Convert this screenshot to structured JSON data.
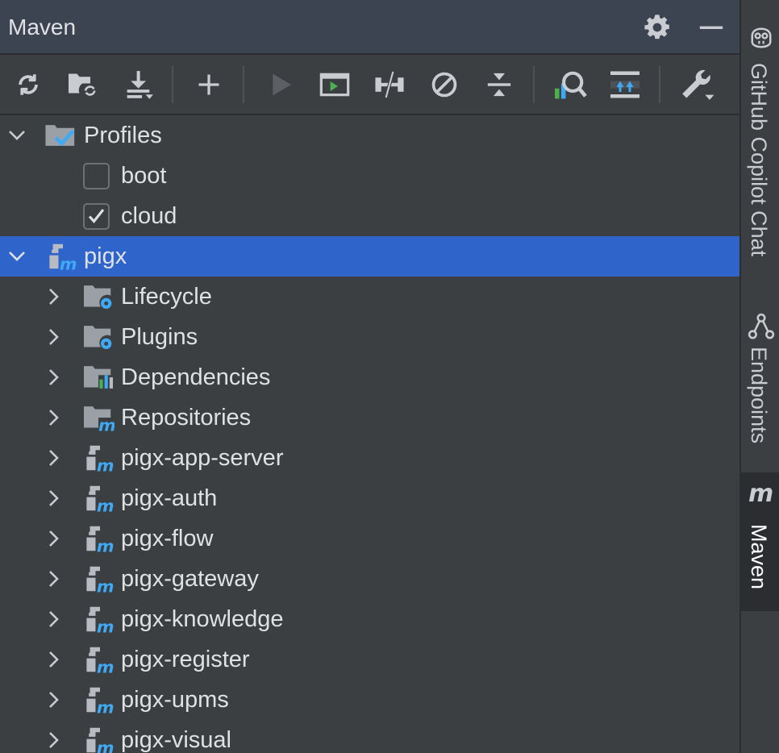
{
  "header": {
    "title": "Maven",
    "settings_icon": "gear-icon",
    "minimize_icon": "minus-icon"
  },
  "toolbar": {
    "buttons": [
      {
        "name": "reload-button",
        "icon": "reload-icon",
        "enabled": true
      },
      {
        "name": "generate-sources-button",
        "icon": "folder-refresh-icon",
        "enabled": true
      },
      {
        "name": "download-button",
        "icon": "download-icon",
        "enabled": true
      },
      {
        "name": "add-button",
        "icon": "plus-icon",
        "enabled": true
      },
      {
        "name": "run-button",
        "icon": "play-icon",
        "enabled": false
      },
      {
        "name": "execute-goal-button",
        "icon": "terminal-icon",
        "enabled": true
      },
      {
        "name": "toggle-offline-button",
        "icon": "offline-icon",
        "enabled": true
      },
      {
        "name": "skip-tests-button",
        "icon": "skip-icon",
        "enabled": true
      },
      {
        "name": "collapse-all-button",
        "icon": "collapse-icon",
        "enabled": true
      },
      {
        "name": "analyze-dependencies-button",
        "icon": "analyze-icon",
        "enabled": true
      },
      {
        "name": "show-dependencies-button",
        "icon": "dependencies-icon",
        "enabled": true
      },
      {
        "name": "maven-settings-button",
        "icon": "wrench-icon",
        "enabled": true
      }
    ]
  },
  "tree": {
    "profiles": {
      "label": "Profiles",
      "expanded": true,
      "items": [
        {
          "label": "boot",
          "checked": false
        },
        {
          "label": "cloud",
          "checked": true
        }
      ]
    },
    "project": {
      "label": "pigx",
      "expanded": true,
      "selected": true
    },
    "children": [
      {
        "label": "Lifecycle",
        "icon": "folder-gear-icon"
      },
      {
        "label": "Plugins",
        "icon": "folder-gear-icon"
      },
      {
        "label": "Dependencies",
        "icon": "folder-chart-icon"
      },
      {
        "label": "Repositories",
        "icon": "folder-maven-icon"
      },
      {
        "label": "pigx-app-server",
        "icon": "maven-module-icon"
      },
      {
        "label": "pigx-auth",
        "icon": "maven-module-icon"
      },
      {
        "label": "pigx-flow",
        "icon": "maven-module-icon"
      },
      {
        "label": "pigx-gateway",
        "icon": "maven-module-icon"
      },
      {
        "label": "pigx-knowledge",
        "icon": "maven-module-icon"
      },
      {
        "label": "pigx-register",
        "icon": "maven-module-icon"
      },
      {
        "label": "pigx-upms",
        "icon": "maven-module-icon"
      },
      {
        "label": "pigx-visual",
        "icon": "maven-module-icon"
      }
    ]
  },
  "side_tabs": [
    {
      "label": "GitHub Copilot Chat",
      "icon": "copilot-icon",
      "active": false
    },
    {
      "label": "Endpoints",
      "icon": "endpoints-icon",
      "active": false
    },
    {
      "label": "Maven",
      "icon": "maven-m-icon",
      "active": true
    }
  ],
  "colors": {
    "selection": "#2f65ca",
    "accent_blue": "#3fa9f5",
    "background": "#3c3f41"
  }
}
